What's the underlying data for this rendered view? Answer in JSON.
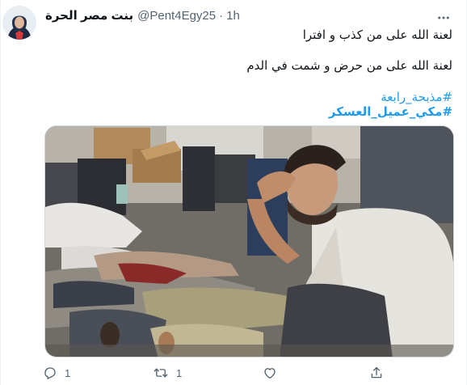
{
  "tweet": {
    "display_name": "بنت مصر الحرة",
    "handle": "@Pent4Egy25",
    "separator": "·",
    "time": "1h",
    "lines": [
      "لعنة الله على من كذب و افترا",
      "لعنة الله على من حرض و شمت في الدم"
    ],
    "hashtags": [
      "#مذبحة_رابعة",
      "#مكي_عميل_العسكر"
    ]
  },
  "actions": {
    "reply_icon": "reply-icon",
    "reply_count": "1",
    "retweet_icon": "retweet-icon",
    "retweet_count": "1",
    "like_icon": "like-icon",
    "share_icon": "share-icon"
  },
  "colors": {
    "link": "#1d9bf0",
    "secondary_text": "#536471",
    "primary_text": "#0f1419"
  }
}
